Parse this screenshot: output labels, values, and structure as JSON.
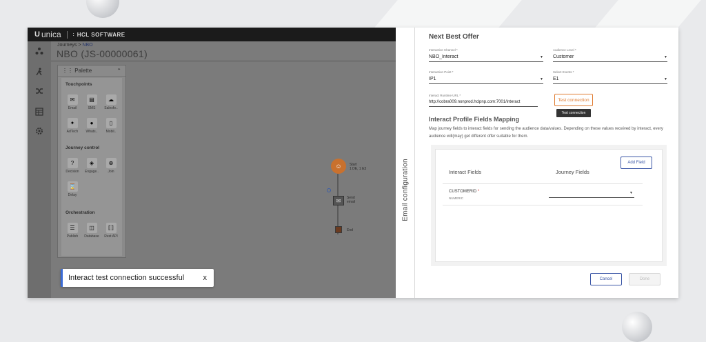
{
  "topbar": {
    "logo_mark": "U",
    "logo_text": "unica",
    "brand": "HCL SOFTWARE"
  },
  "breadcrumb": {
    "parent": "Journeys",
    "separator": ">",
    "current": "NBO"
  },
  "page_title": "NBO (JS-00000061)",
  "palette": {
    "title": "Palette",
    "sections": {
      "touchpoints": "Touchpoints",
      "journey_control": "Journey control",
      "orchestration": "Orchestration"
    },
    "tiles": {
      "email": "Email",
      "sms": "SMS",
      "salesforce": "Salesfo..",
      "adtech": "AdTech",
      "whatsapp": "Whats..",
      "mobile": "Mobil..",
      "decision": "Decision",
      "engagement": "Engage..",
      "join": "Join",
      "delay": "Delay",
      "publish": "Publish",
      "database": "Database",
      "rest_api": "Rest API"
    }
  },
  "canvas": {
    "start_label": "Start",
    "start_sub": "1 DE, 1 E3",
    "send_label": "Send",
    "send_sub": "email",
    "end_label": "End"
  },
  "toast": {
    "message": "Interact test connection successful",
    "close": "x"
  },
  "side_tab": {
    "label": "Email configuration"
  },
  "panel": {
    "title": "Next Best Offer",
    "interactive_channel": {
      "label": "Interactive Channel *",
      "value": "NBO_Interact"
    },
    "audience_level": {
      "label": "Audience Level *",
      "value": "Customer"
    },
    "interaction_point": {
      "label": "Interaction Point *",
      "value": "IP1"
    },
    "select_events": {
      "label": "Select Events *",
      "value": "E1"
    },
    "runtime_url": {
      "label": "Interact Runtime URL *",
      "value": "http://cobra009.nonprod.hclpnp.com:7001/interact"
    },
    "test_connection": "Test connection",
    "tooltip": "Test connection",
    "mapping_title": "Interact Profile Fields Mapping",
    "mapping_desc": "Map journey fields to interact fields for sending the audience data/values. Depending on these values received by interact, every audience will(may) get different offer suitable for them.",
    "add_field": "Add Field",
    "col_interact": "Interact Fields",
    "col_journey": "Journey Fields",
    "row": {
      "field": "CUSTOMERID",
      "required": "*",
      "type": "NUMERIC"
    },
    "cancel": "Cancel",
    "done": "Done"
  },
  "colors": {
    "accent_orange": "#e07b30",
    "primary_blue": "#3a56a6",
    "toast_border": "#3a6bd6"
  },
  "icons": [
    "journeys-icon",
    "run-icon",
    "shuffle-icon",
    "table-icon",
    "settings-icon"
  ]
}
